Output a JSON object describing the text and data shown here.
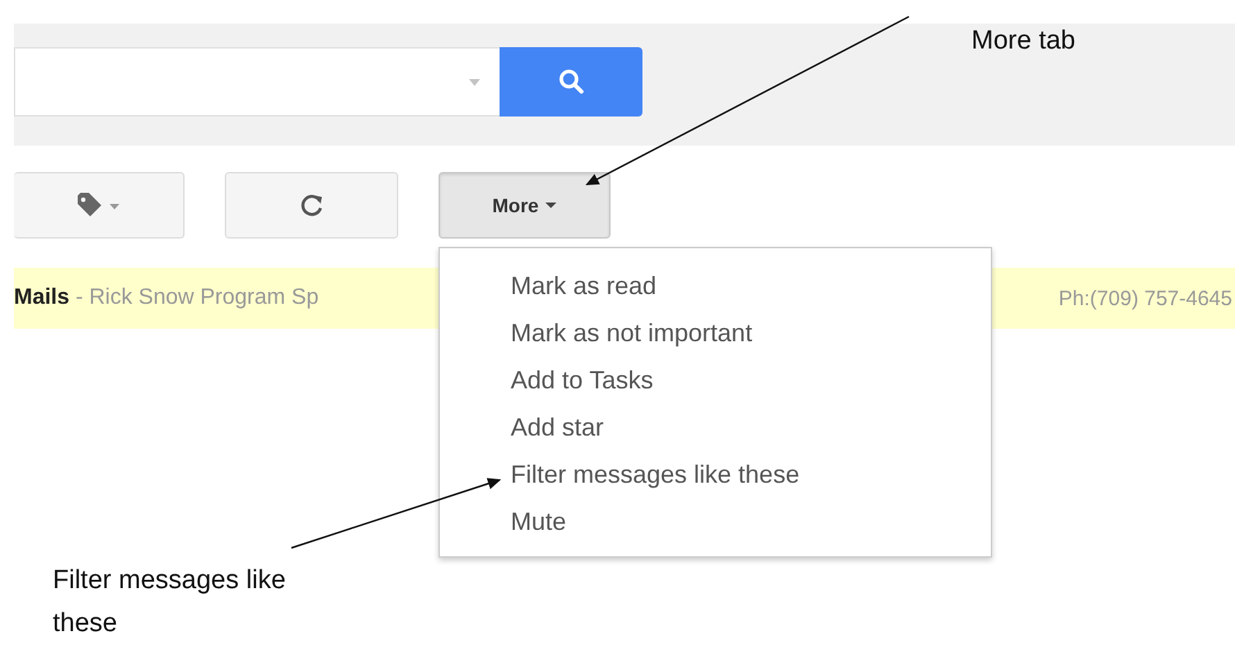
{
  "toolbar": {
    "more_button": {
      "label": "More",
      "pressed": true
    }
  },
  "mail_row": {
    "left_text": "**Mails** - Rick Snow Program Sp",
    "right_text": "Ph:(709) 757-4645"
  },
  "more_menu": {
    "items": [
      {
        "label": "Mark as read"
      },
      {
        "label": "Mark as not important"
      },
      {
        "label": "Add to Tasks"
      },
      {
        "label": "Add star"
      },
      {
        "label": "Filter messages like these"
      },
      {
        "label": "Mute"
      }
    ]
  },
  "annotations": [
    {
      "text": "More tab",
      "kind": "top"
    },
    {
      "text": "Filter messages like these",
      "kind": "bottom"
    }
  ]
}
